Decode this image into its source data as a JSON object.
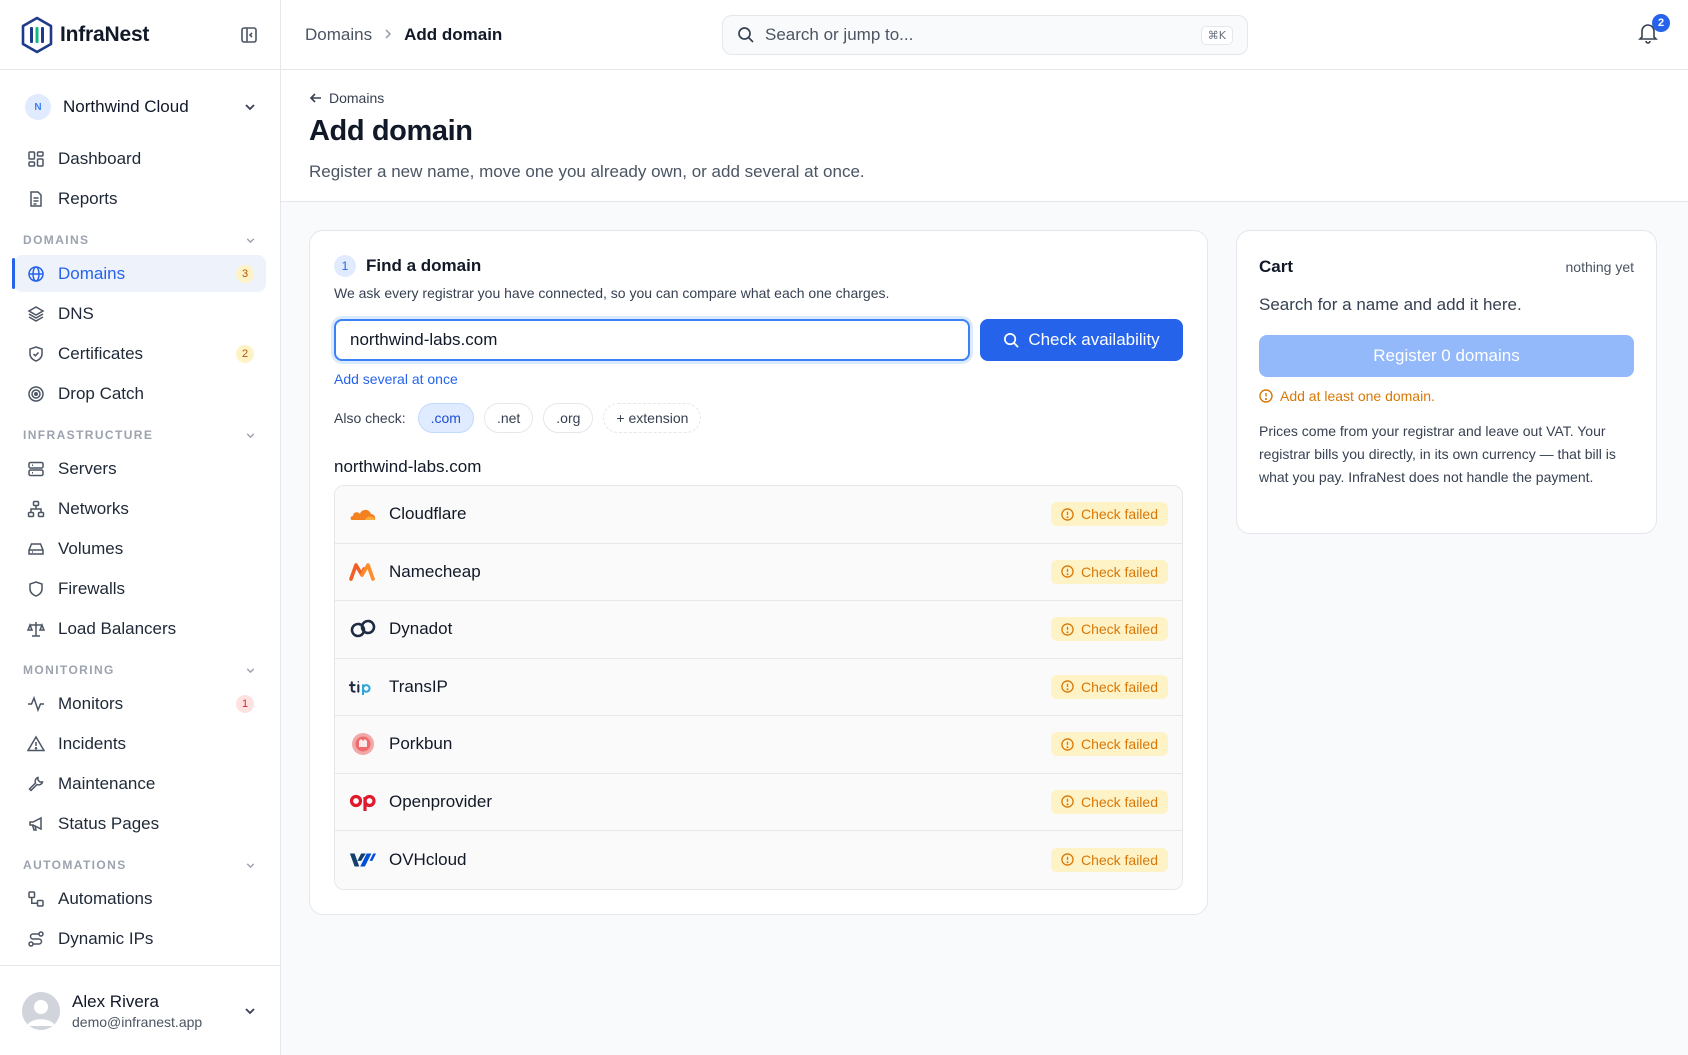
{
  "brand": {
    "name": "InfraNest"
  },
  "org": {
    "initial": "N",
    "name": "Northwind Cloud"
  },
  "nav": {
    "top": [
      {
        "label": "Dashboard",
        "icon": "dashboard-icon"
      },
      {
        "label": "Reports",
        "icon": "reports-icon"
      }
    ],
    "sections": [
      {
        "title": "DOMAINS",
        "items": [
          {
            "label": "Domains",
            "badge": "3",
            "active": true
          },
          {
            "label": "DNS"
          },
          {
            "label": "Certificates",
            "badge": "2"
          },
          {
            "label": "Drop Catch"
          }
        ]
      },
      {
        "title": "INFRASTRUCTURE",
        "items": [
          {
            "label": "Servers"
          },
          {
            "label": "Networks"
          },
          {
            "label": "Volumes"
          },
          {
            "label": "Firewalls"
          },
          {
            "label": "Load Balancers"
          }
        ]
      },
      {
        "title": "MONITORING",
        "items": [
          {
            "label": "Monitors",
            "badge": "1"
          },
          {
            "label": "Incidents"
          },
          {
            "label": "Maintenance"
          },
          {
            "label": "Status Pages"
          }
        ]
      },
      {
        "title": "AUTOMATIONS",
        "items": [
          {
            "label": "Automations"
          },
          {
            "label": "Dynamic IPs"
          }
        ]
      }
    ]
  },
  "user": {
    "name": "Alex Rivera",
    "email": "demo@infranest.app"
  },
  "topbar": {
    "breadcrumb": {
      "parent": "Domains",
      "current": "Add domain"
    },
    "search_placeholder": "Search or jump to...",
    "search_shortcut": "⌘K",
    "notifications": "2"
  },
  "page": {
    "back_label": "Domains",
    "title": "Add domain",
    "subtitle": "Register a new name, move one you already own, or add several at once."
  },
  "find": {
    "step": "1",
    "title": "Find a domain",
    "description": "We ask every registrar you have connected, so you can compare what each one charges.",
    "query": "northwind-labs.com",
    "check_label": "Check availability",
    "several_label": "Add several at once",
    "also_label": "Also check:",
    "extensions": [
      ".com",
      ".net",
      ".org"
    ],
    "add_extension": "+ extension",
    "result_domain": "northwind-labs.com",
    "status_label": "Check failed",
    "registrars": [
      "Cloudflare",
      "Namecheap",
      "Dynadot",
      "TransIP",
      "Porkbun",
      "Openprovider",
      "OVHcloud"
    ]
  },
  "cart": {
    "title": "Cart",
    "meta": "nothing yet",
    "empty": "Search for a name and add it here.",
    "register_label": "Register 0 domains",
    "warning": "Add at least one domain.",
    "note": "Prices come from your registrar and leave out VAT. Your registrar bills you directly, in its own currency — that bill is what you pay. InfraNest does not handle the payment."
  },
  "colors": {
    "accent": "#2563eb",
    "warning": "#d97706",
    "warning_bg": "#fef3c7"
  }
}
